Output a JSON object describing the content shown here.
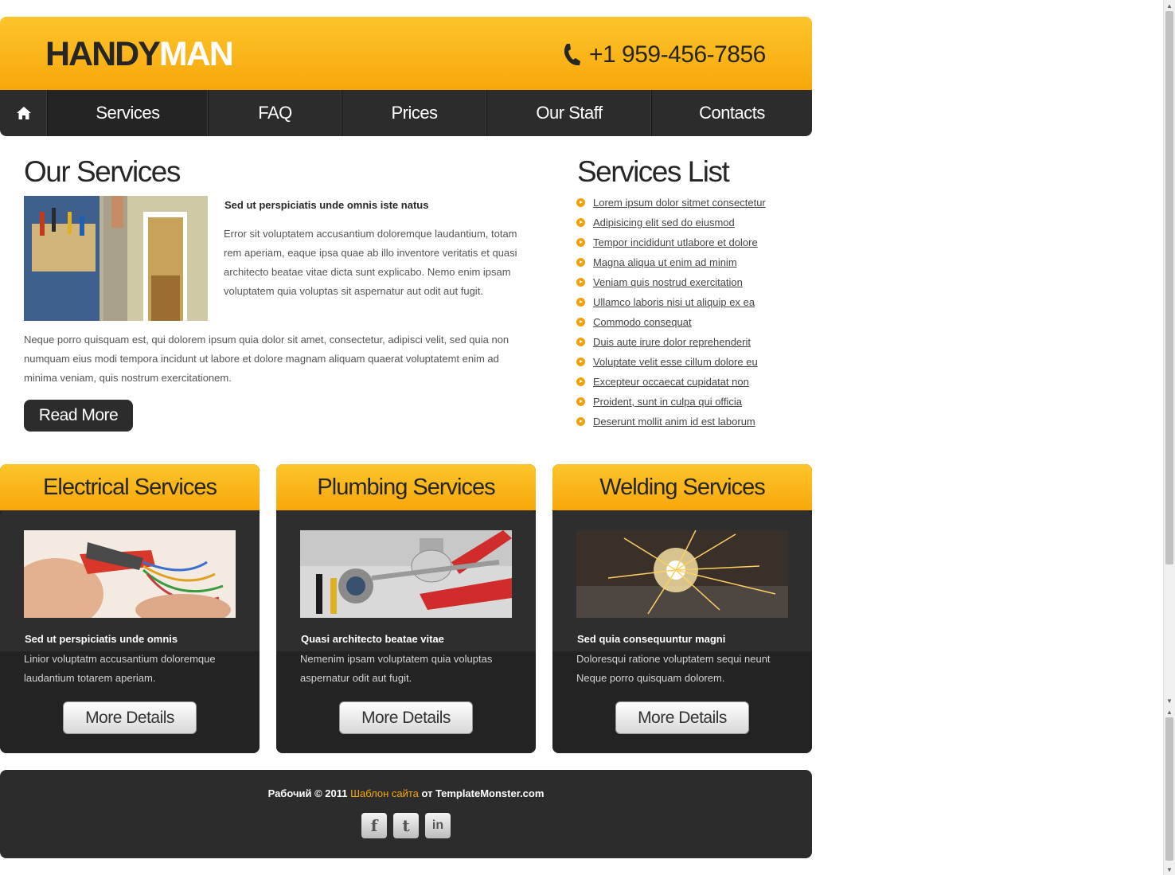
{
  "header": {
    "logo_part1": "HANDY",
    "logo_part2": "MAN",
    "phone": "+1 959-456-7856"
  },
  "nav": {
    "items": [
      "Services",
      "FAQ",
      "Prices",
      "Our Staff",
      "Contacts"
    ]
  },
  "main": {
    "title": "Our Services",
    "intro_heading": "Sed ut perspiciatis unde omnis iste natus",
    "intro_text": "Error sit voluptatem accusantium doloremque laudantium, totam rem aperiam, eaque ipsa quae ab illo inventore veritatis et quasi architecto beatae vitae dicta sunt explicabo. Nemo enim ipsam voluptatem quia voluptas sit aspernatur aut odit aut fugit.",
    "body_text": "Neque porro quisquam est, qui dolorem ipsum quia dolor sit amet, consectetur, adipisci velit, sed quia non numquam eius modi tempora incidunt ut labore et dolore magnam aliquam quaerat voluptatemt enim ad minima veniam, quis nostrum exercitationem.",
    "read_more": "Read More"
  },
  "services_list": {
    "title": "Services List",
    "items": [
      "Lorem ipsum dolor sitmet consectetur",
      "Adipisicing elit sed do eiusmod",
      "Tempor incididunt utlabore et dolore",
      "Magna aliqua ut enim ad minim",
      "Veniam quis nostrud exercitation",
      "Ullamco laboris nisi ut aliquip ex ea",
      "Commodo consequat",
      "Duis aute irure dolor reprehenderit",
      "Voluptate velit esse cillum dolore eu",
      "Excepteur occaecat cupidatat non",
      "Proident, sunt in culpa qui officia",
      "Deserunt mollit anim id est laborum"
    ]
  },
  "cards": [
    {
      "title": "Electrical Services",
      "subtitle": "Sed ut perspiciatis unde omnis",
      "text": "Linior voluptatm accusantium doloremque laudantium totarem aperiam.",
      "button": "More Details"
    },
    {
      "title": "Plumbing Services",
      "subtitle": "Quasi architecto beatae vitae",
      "text": "Nemenim ipsam voluptatem quia voluptas aspernatur odit aut fugit.",
      "button": "More Details"
    },
    {
      "title": "Welding Services",
      "subtitle": "Sed quia consequuntur magni",
      "text": "Doloresqui ratione voluptatem sequi neunt Neque porro quisquam dolorem.",
      "button": "More Details"
    }
  ],
  "footer": {
    "copy_prefix": "Рабочий © 2011 ",
    "copy_link": "Шаблон сайта",
    "copy_suffix": " от TemplateMonster.com",
    "social": [
      "facebook-icon",
      "twitter-icon",
      "linkedin-icon"
    ]
  },
  "colors": {
    "accent": "#f8a70a",
    "dark": "#2c2c2c"
  }
}
